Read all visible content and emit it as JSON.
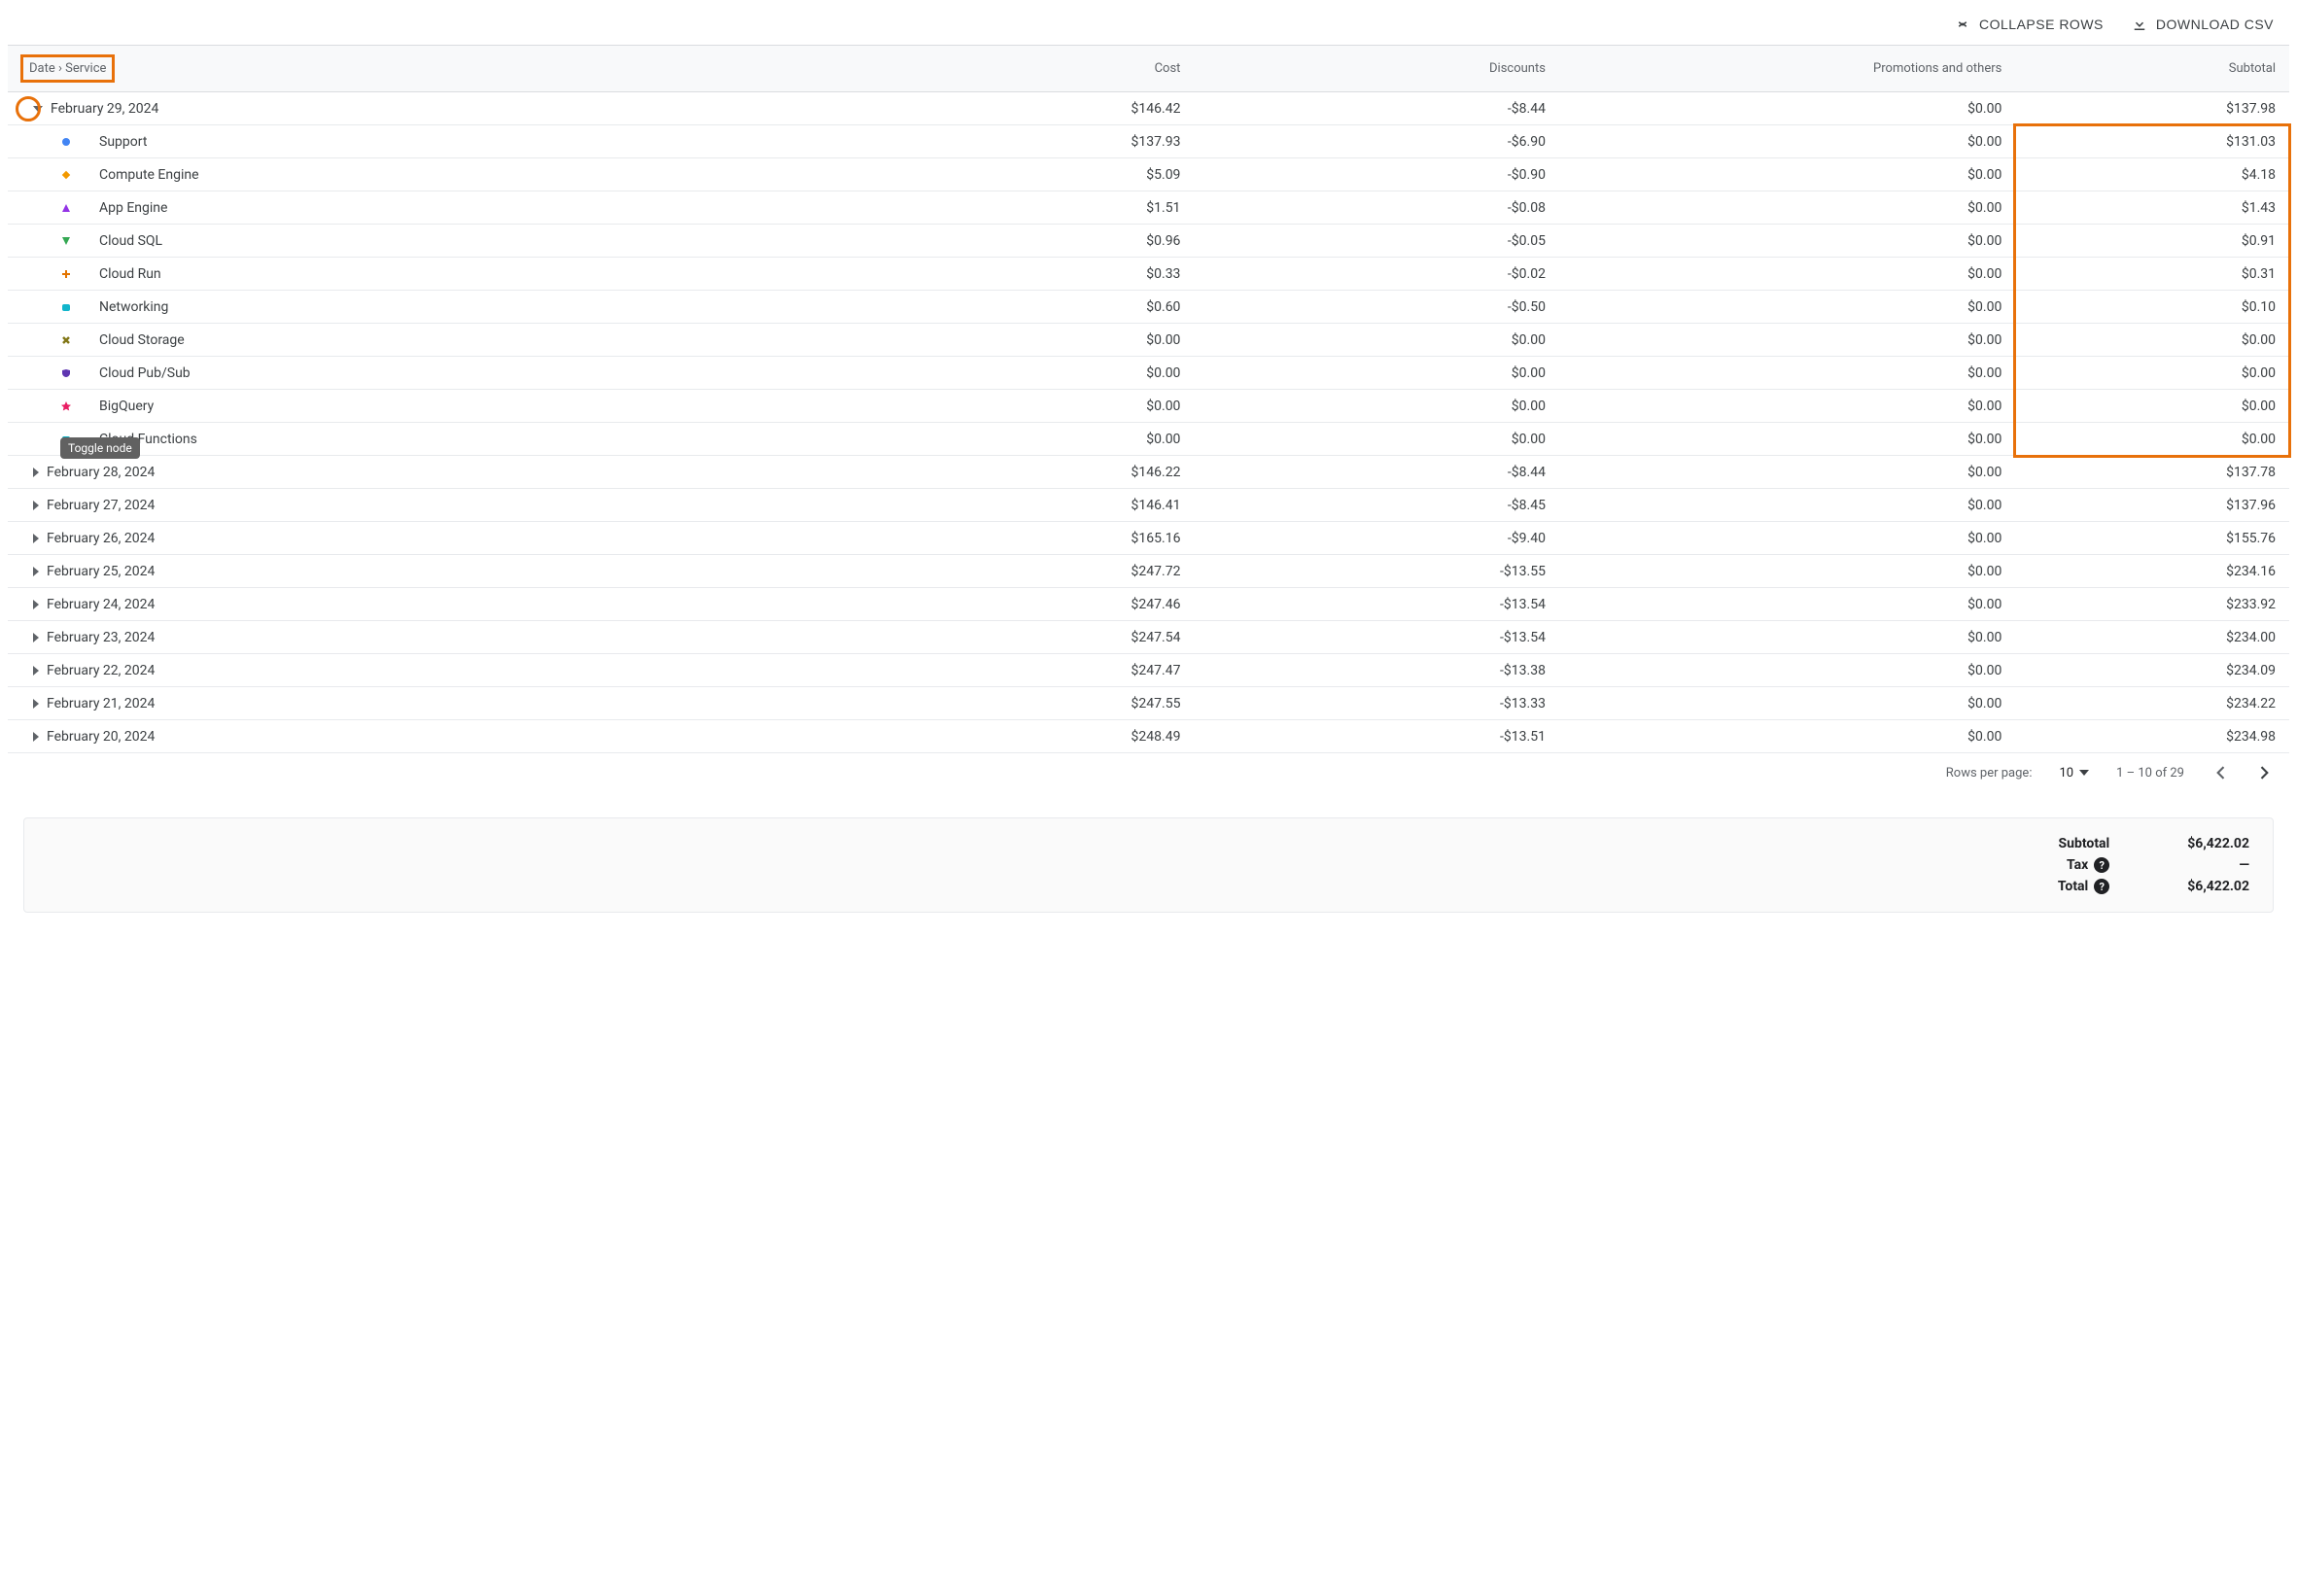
{
  "toolbar": {
    "collapse_label": "COLLAPSE ROWS",
    "download_label": "DOWNLOAD CSV"
  },
  "columns": {
    "name": "Date › Service",
    "cost": "Cost",
    "discounts": "Discounts",
    "promotions": "Promotions and others",
    "subtotal": "Subtotal"
  },
  "tooltip": "Toggle node",
  "service_markers": [
    {
      "shape": "circle",
      "color": "#4285f4"
    },
    {
      "shape": "diamond",
      "color": "#f29900"
    },
    {
      "shape": "triangle-up",
      "color": "#9334e6"
    },
    {
      "shape": "triangle-down",
      "color": "#34a853"
    },
    {
      "shape": "plus",
      "color": "#e37400"
    },
    {
      "shape": "square-round",
      "color": "#12b5cb"
    },
    {
      "shape": "x",
      "color": "#827717"
    },
    {
      "shape": "shield",
      "color": "#5e35b1"
    },
    {
      "shape": "star",
      "color": "#e91e63"
    },
    {
      "shape": "square-round",
      "color": "#00acc1"
    }
  ],
  "expanded": {
    "date": "February 29, 2024",
    "cost": "$146.42",
    "discounts": "-$8.44",
    "promotions": "$0.00",
    "subtotal": "$137.98",
    "services": [
      {
        "name": "Support",
        "cost": "$137.93",
        "discounts": "-$6.90",
        "promotions": "$0.00",
        "subtotal": "$131.03"
      },
      {
        "name": "Compute Engine",
        "cost": "$5.09",
        "discounts": "-$0.90",
        "promotions": "$0.00",
        "subtotal": "$4.18"
      },
      {
        "name": "App Engine",
        "cost": "$1.51",
        "discounts": "-$0.08",
        "promotions": "$0.00",
        "subtotal": "$1.43"
      },
      {
        "name": "Cloud SQL",
        "cost": "$0.96",
        "discounts": "-$0.05",
        "promotions": "$0.00",
        "subtotal": "$0.91"
      },
      {
        "name": "Cloud Run",
        "cost": "$0.33",
        "discounts": "-$0.02",
        "promotions": "$0.00",
        "subtotal": "$0.31"
      },
      {
        "name": "Networking",
        "cost": "$0.60",
        "discounts": "-$0.50",
        "promotions": "$0.00",
        "subtotal": "$0.10"
      },
      {
        "name": "Cloud Storage",
        "cost": "$0.00",
        "discounts": "$0.00",
        "promotions": "$0.00",
        "subtotal": "$0.00"
      },
      {
        "name": "Cloud Pub/Sub",
        "cost": "$0.00",
        "discounts": "$0.00",
        "promotions": "$0.00",
        "subtotal": "$0.00"
      },
      {
        "name": "BigQuery",
        "cost": "$0.00",
        "discounts": "$0.00",
        "promotions": "$0.00",
        "subtotal": "$0.00"
      },
      {
        "name": "Cloud Functions",
        "cost": "$0.00",
        "discounts": "$0.00",
        "promotions": "$0.00",
        "subtotal": "$0.00"
      }
    ]
  },
  "collapsed_rows": [
    {
      "date": "February 28, 2024",
      "cost": "$146.22",
      "discounts": "-$8.44",
      "promotions": "$0.00",
      "subtotal": "$137.78"
    },
    {
      "date": "February 27, 2024",
      "cost": "$146.41",
      "discounts": "-$8.45",
      "promotions": "$0.00",
      "subtotal": "$137.96"
    },
    {
      "date": "February 26, 2024",
      "cost": "$165.16",
      "discounts": "-$9.40",
      "promotions": "$0.00",
      "subtotal": "$155.76"
    },
    {
      "date": "February 25, 2024",
      "cost": "$247.72",
      "discounts": "-$13.55",
      "promotions": "$0.00",
      "subtotal": "$234.16"
    },
    {
      "date": "February 24, 2024",
      "cost": "$247.46",
      "discounts": "-$13.54",
      "promotions": "$0.00",
      "subtotal": "$233.92"
    },
    {
      "date": "February 23, 2024",
      "cost": "$247.54",
      "discounts": "-$13.54",
      "promotions": "$0.00",
      "subtotal": "$234.00"
    },
    {
      "date": "February 22, 2024",
      "cost": "$247.47",
      "discounts": "-$13.38",
      "promotions": "$0.00",
      "subtotal": "$234.09"
    },
    {
      "date": "February 21, 2024",
      "cost": "$247.55",
      "discounts": "-$13.33",
      "promotions": "$0.00",
      "subtotal": "$234.22"
    },
    {
      "date": "February 20, 2024",
      "cost": "$248.49",
      "discounts": "-$13.51",
      "promotions": "$0.00",
      "subtotal": "$234.98"
    }
  ],
  "pagination": {
    "rows_label": "Rows per page:",
    "rows_value": "10",
    "range": "1 – 10 of 29"
  },
  "summary": {
    "subtotal_label": "Subtotal",
    "subtotal_value": "$6,422.02",
    "tax_label": "Tax",
    "tax_value": "—",
    "total_label": "Total",
    "total_value": "$6,422.02"
  }
}
